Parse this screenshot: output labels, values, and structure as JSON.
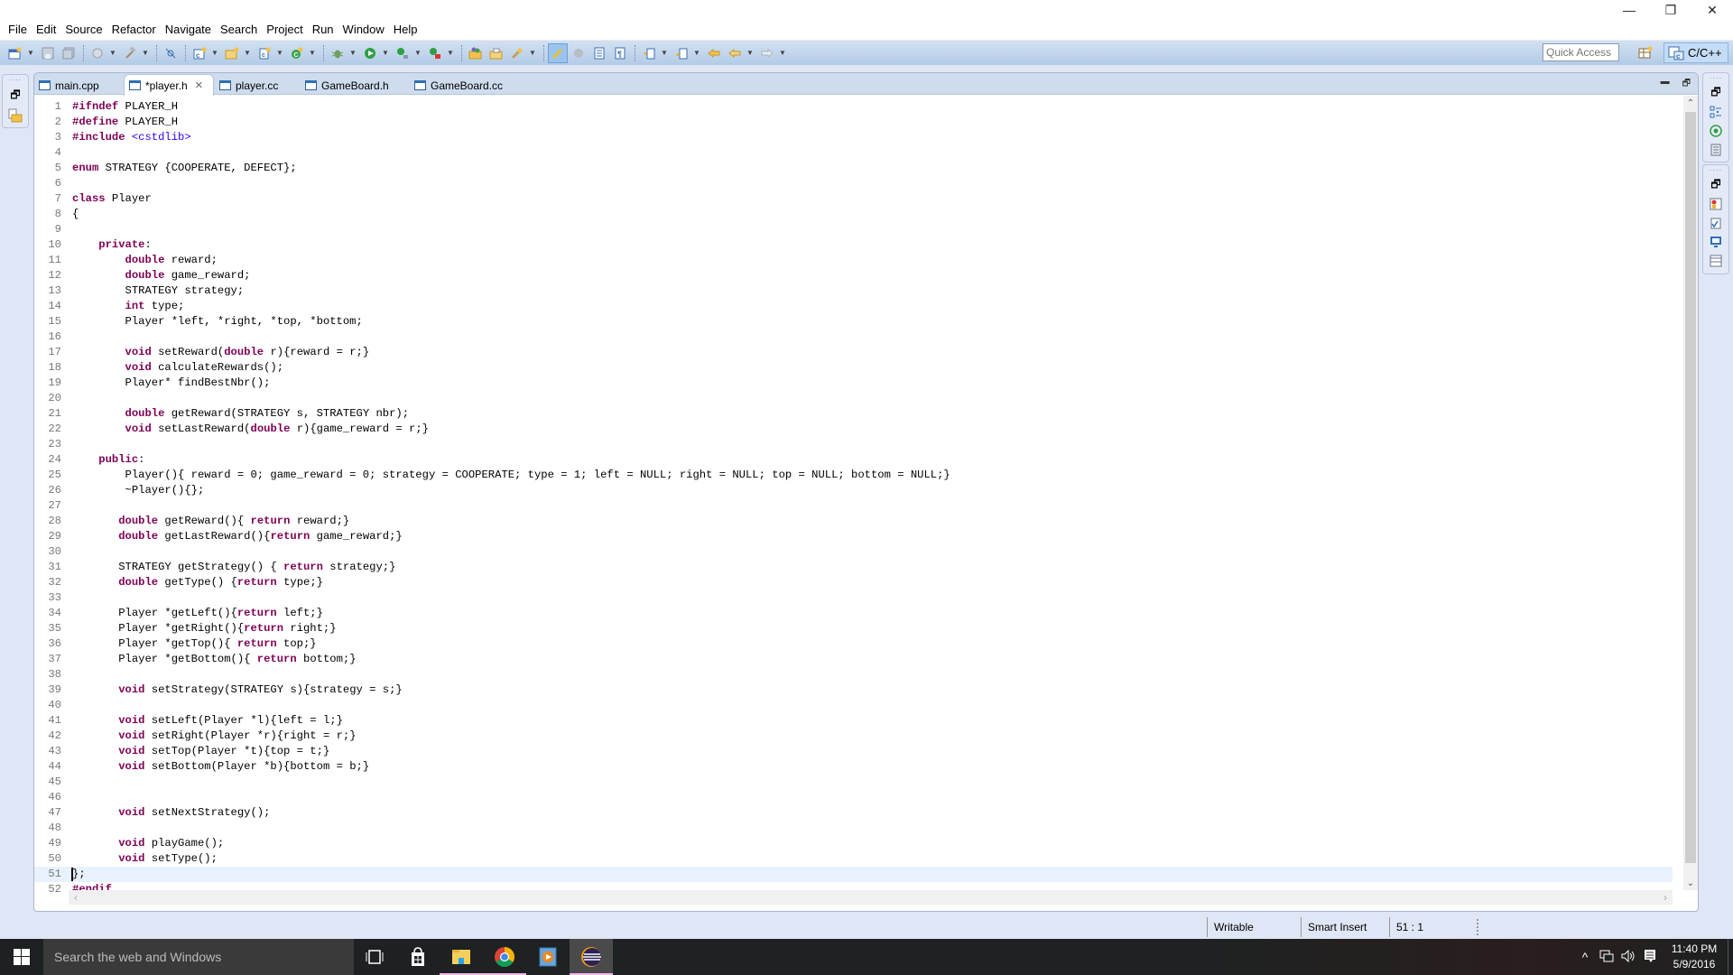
{
  "window": {
    "controls": {
      "minimize": "—",
      "restore": "❐",
      "close": "✕"
    }
  },
  "menu": [
    "File",
    "Edit",
    "Source",
    "Refactor",
    "Navigate",
    "Search",
    "Project",
    "Run",
    "Window",
    "Help"
  ],
  "toolbar": {
    "quick_access_placeholder": "Quick Access",
    "perspective_label": "C/C++"
  },
  "tabs": [
    {
      "label": "main.cpp",
      "active": false
    },
    {
      "label": "*player.h",
      "active": true,
      "close": "✕"
    },
    {
      "label": "player.cc",
      "active": false
    },
    {
      "label": "GameBoard.h",
      "active": false
    },
    {
      "label": "GameBoard.cc",
      "active": false
    }
  ],
  "editor": {
    "current_line": 51,
    "lines": [
      [
        [
          "kw",
          "#ifndef"
        ],
        [
          "t",
          " PLAYER_H"
        ]
      ],
      [
        [
          "kw",
          "#define"
        ],
        [
          "t",
          " PLAYER_H"
        ]
      ],
      [
        [
          "kw",
          "#include"
        ],
        [
          "t",
          " "
        ],
        [
          "str",
          "<cstdlib>"
        ]
      ],
      [],
      [
        [
          "kw",
          "enum"
        ],
        [
          "t",
          " STRATEGY {COOPERATE, DEFECT};"
        ]
      ],
      [],
      [
        [
          "kw",
          "class"
        ],
        [
          "t",
          " Player"
        ]
      ],
      [
        [
          "t",
          "{"
        ]
      ],
      [],
      [
        [
          "t",
          "    "
        ],
        [
          "kw",
          "private"
        ],
        [
          "t",
          ":"
        ]
      ],
      [
        [
          "t",
          "        "
        ],
        [
          "kw",
          "double"
        ],
        [
          "t",
          " reward;"
        ]
      ],
      [
        [
          "t",
          "        "
        ],
        [
          "kw",
          "double"
        ],
        [
          "t",
          " game_reward;"
        ]
      ],
      [
        [
          "t",
          "        STRATEGY strategy;"
        ]
      ],
      [
        [
          "t",
          "        "
        ],
        [
          "kw",
          "int"
        ],
        [
          "t",
          " type;"
        ]
      ],
      [
        [
          "t",
          "        Player *left, *right, *top, *bottom;"
        ]
      ],
      [],
      [
        [
          "t",
          "        "
        ],
        [
          "kw",
          "void"
        ],
        [
          "t",
          " setReward("
        ],
        [
          "kw",
          "double"
        ],
        [
          "t",
          " r){reward = r;}"
        ]
      ],
      [
        [
          "t",
          "        "
        ],
        [
          "kw",
          "void"
        ],
        [
          "t",
          " calculateRewards();"
        ]
      ],
      [
        [
          "t",
          "        Player* findBestNbr();"
        ]
      ],
      [],
      [
        [
          "t",
          "        "
        ],
        [
          "kw",
          "double"
        ],
        [
          "t",
          " getReward(STRATEGY s, STRATEGY nbr);"
        ]
      ],
      [
        [
          "t",
          "        "
        ],
        [
          "kw",
          "void"
        ],
        [
          "t",
          " setLastReward("
        ],
        [
          "kw",
          "double"
        ],
        [
          "t",
          " r){game_reward = r;}"
        ]
      ],
      [],
      [
        [
          "t",
          "    "
        ],
        [
          "kw",
          "public"
        ],
        [
          "t",
          ":"
        ]
      ],
      [
        [
          "t",
          "        Player(){ reward = 0; game_reward = 0; strategy = COOPERATE; type = 1; left = NULL; right = NULL; top = NULL; bottom = NULL;}"
        ]
      ],
      [
        [
          "t",
          "        ~Player(){};"
        ]
      ],
      [],
      [
        [
          "t",
          "       "
        ],
        [
          "kw",
          "double"
        ],
        [
          "t",
          " getReward(){ "
        ],
        [
          "kw",
          "return"
        ],
        [
          "t",
          " reward;}"
        ]
      ],
      [
        [
          "t",
          "       "
        ],
        [
          "kw",
          "double"
        ],
        [
          "t",
          " getLastReward(){"
        ],
        [
          "kw",
          "return"
        ],
        [
          "t",
          " game_reward;}"
        ]
      ],
      [],
      [
        [
          "t",
          "       STRATEGY getStrategy() { "
        ],
        [
          "kw",
          "return"
        ],
        [
          "t",
          " strategy;}"
        ]
      ],
      [
        [
          "t",
          "       "
        ],
        [
          "kw",
          "double"
        ],
        [
          "t",
          " getType() {"
        ],
        [
          "kw",
          "return"
        ],
        [
          "t",
          " type;}"
        ]
      ],
      [],
      [
        [
          "t",
          "       Player *getLeft(){"
        ],
        [
          "kw",
          "return"
        ],
        [
          "t",
          " left;}"
        ]
      ],
      [
        [
          "t",
          "       Player *getRight(){"
        ],
        [
          "kw",
          "return"
        ],
        [
          "t",
          " right;}"
        ]
      ],
      [
        [
          "t",
          "       Player *getTop(){ "
        ],
        [
          "kw",
          "return"
        ],
        [
          "t",
          " top;}"
        ]
      ],
      [
        [
          "t",
          "       Player *getBottom(){ "
        ],
        [
          "kw",
          "return"
        ],
        [
          "t",
          " bottom;}"
        ]
      ],
      [],
      [
        [
          "t",
          "       "
        ],
        [
          "kw",
          "void"
        ],
        [
          "t",
          " setStrategy(STRATEGY s){strategy = s;}"
        ]
      ],
      [],
      [
        [
          "t",
          "       "
        ],
        [
          "kw",
          "void"
        ],
        [
          "t",
          " setLeft(Player *l){left = l;}"
        ]
      ],
      [
        [
          "t",
          "       "
        ],
        [
          "kw",
          "void"
        ],
        [
          "t",
          " setRight(Player *r){right = r;}"
        ]
      ],
      [
        [
          "t",
          "       "
        ],
        [
          "kw",
          "void"
        ],
        [
          "t",
          " setTop(Player *t){top = t;}"
        ]
      ],
      [
        [
          "t",
          "       "
        ],
        [
          "kw",
          "void"
        ],
        [
          "t",
          " setBottom(Player *b){bottom = b;}"
        ]
      ],
      [],
      [],
      [
        [
          "t",
          "       "
        ],
        [
          "kw",
          "void"
        ],
        [
          "t",
          " setNextStrategy();"
        ]
      ],
      [],
      [
        [
          "t",
          "       "
        ],
        [
          "kw",
          "void"
        ],
        [
          "t",
          " playGame();"
        ]
      ],
      [
        [
          "t",
          "       "
        ],
        [
          "kw",
          "void"
        ],
        [
          "t",
          " setType();"
        ]
      ],
      [
        [
          "t",
          "};"
        ]
      ],
      [
        [
          "kw",
          "#endif"
        ]
      ]
    ]
  },
  "status": {
    "writable": "Writable",
    "insert_mode": "Smart Insert",
    "cursor_position": "51 : 1"
  },
  "taskbar": {
    "search_placeholder": "Search the web and Windows",
    "time": "11:40 PM",
    "date": "5/9/2016"
  },
  "colors": {
    "keyword": "#7f0055",
    "string": "#2a00ff",
    "line_number": "#787878",
    "current_line": "#e8f2fe"
  }
}
